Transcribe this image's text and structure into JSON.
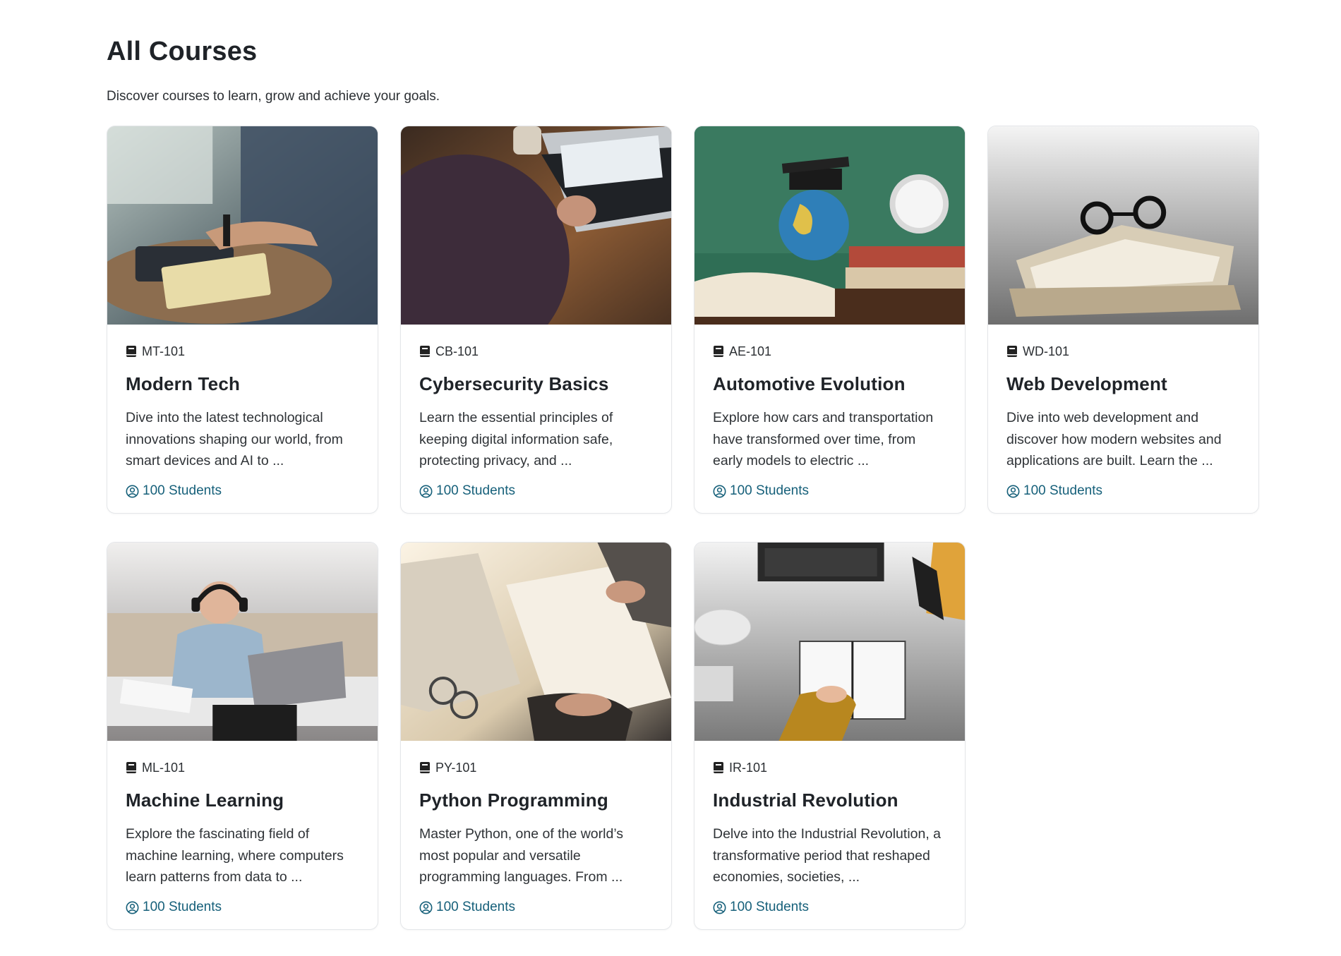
{
  "page": {
    "title": "All Courses",
    "subtitle": "Discover courses to learn, grow and achieve your goals."
  },
  "courses": [
    {
      "code": "MT-101",
      "title": "Modern Tech",
      "description": "Dive into the latest technological innovations shaping our world, from smart devices and AI to ...",
      "students": "100 Students",
      "image": "laptop-typing-photo"
    },
    {
      "code": "CB-101",
      "title": "Cybersecurity Basics",
      "description": "Learn the essential principles of keeping digital information safe, protecting privacy, and ...",
      "students": "100 Students",
      "image": "laptop-desk-photo"
    },
    {
      "code": "AE-101",
      "title": "Automotive Evolution",
      "description": "Explore how cars and transportation have transformed over time, from early models to electric ...",
      "students": "100 Students",
      "image": "globe-books-clock-photo"
    },
    {
      "code": "WD-101",
      "title": "Web Development",
      "description": "Dive into web development and discover how modern websites and applications are built. Learn the ...",
      "students": "100 Students",
      "image": "glasses-books-photo"
    },
    {
      "code": "ML-101",
      "title": "Machine Learning",
      "description": "Explore the fascinating field of machine learning, where computers learn patterns from data to ...",
      "students": "100 Students",
      "image": "man-headphones-laptop-photo"
    },
    {
      "code": "PY-101",
      "title": "Python Programming",
      "description": "Master Python, one of the world’s most popular and versatile programming languages. From ...",
      "students": "100 Students",
      "image": "desk-writing-calculator-photo"
    },
    {
      "code": "IR-101",
      "title": "Industrial Revolution",
      "description": "Delve into the Industrial Revolution, a transformative period that reshaped economies, societies, ...",
      "students": "100 Students",
      "image": "laptop-notebook-topdown-photo"
    }
  ],
  "colors": {
    "accent": "#16607a",
    "title": "#1f2328",
    "border": "#e4e6e9"
  }
}
